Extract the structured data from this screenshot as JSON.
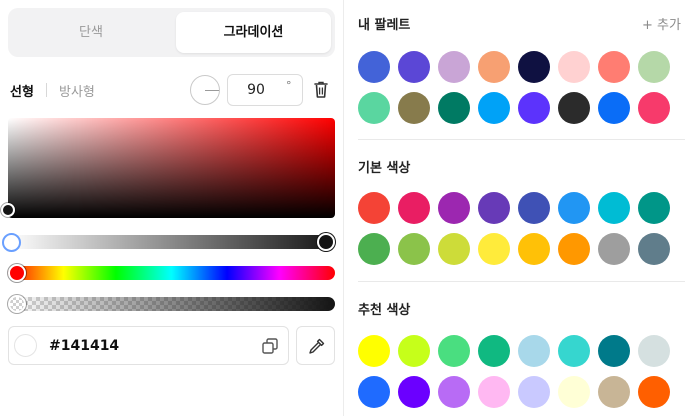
{
  "mode_tabs": {
    "solid": "단색",
    "gradient": "그라데이션",
    "active": "gradient"
  },
  "gradient_type": {
    "linear": "선형",
    "radial": "방사형",
    "active": "linear"
  },
  "angle": {
    "value": "90",
    "unit": "°"
  },
  "hex": {
    "value": "#141414"
  },
  "colors": {
    "picker_hue": "#ff0000",
    "stop_start": "#ffffff",
    "stop_end": "#141414",
    "accent": "#6aa0ff"
  },
  "icons": {
    "angle": "angle-dial-icon",
    "delete": "trash-icon",
    "copy": "copy-icon",
    "eyedropper": "eyedropper-icon"
  },
  "palette": {
    "title": "내 팔레트",
    "add_label": "+ 추가",
    "colors": [
      "#4363d8",
      "#5b47d6",
      "#c9a5d6",
      "#f7a072",
      "#0f1141",
      "#ffd1d1",
      "#ff7d72",
      "#b5d8a8",
      "#5ad6a0",
      "#877b4c",
      "#007a63",
      "#00a2f7",
      "#5c33fc",
      "#2b2b2b",
      "#0a6df7",
      "#f73a6b"
    ]
  },
  "basic": {
    "title": "기본 색상",
    "colors": [
      "#f44336",
      "#e91e63",
      "#9c27b0",
      "#673ab7",
      "#3f51b5",
      "#2196f3",
      "#00bcd4",
      "#009688",
      "#4caf50",
      "#8bc34a",
      "#cddc39",
      "#ffeb3b",
      "#ffc107",
      "#ff9800",
      "#9e9e9e",
      "#607d8b"
    ]
  },
  "recommended": {
    "title": "추천 색상",
    "colors": [
      "#ffff00",
      "#c6ff1a",
      "#4ade80",
      "#10b981",
      "#a8d8ea",
      "#36d6cf",
      "#007a8a",
      "#d5e0e0",
      "#1f6bff",
      "#6b00ff",
      "#b86bf5",
      "#ffb8f2",
      "#c9c9ff",
      "#ffffd6",
      "#c8b596",
      "#ff5f00"
    ]
  }
}
